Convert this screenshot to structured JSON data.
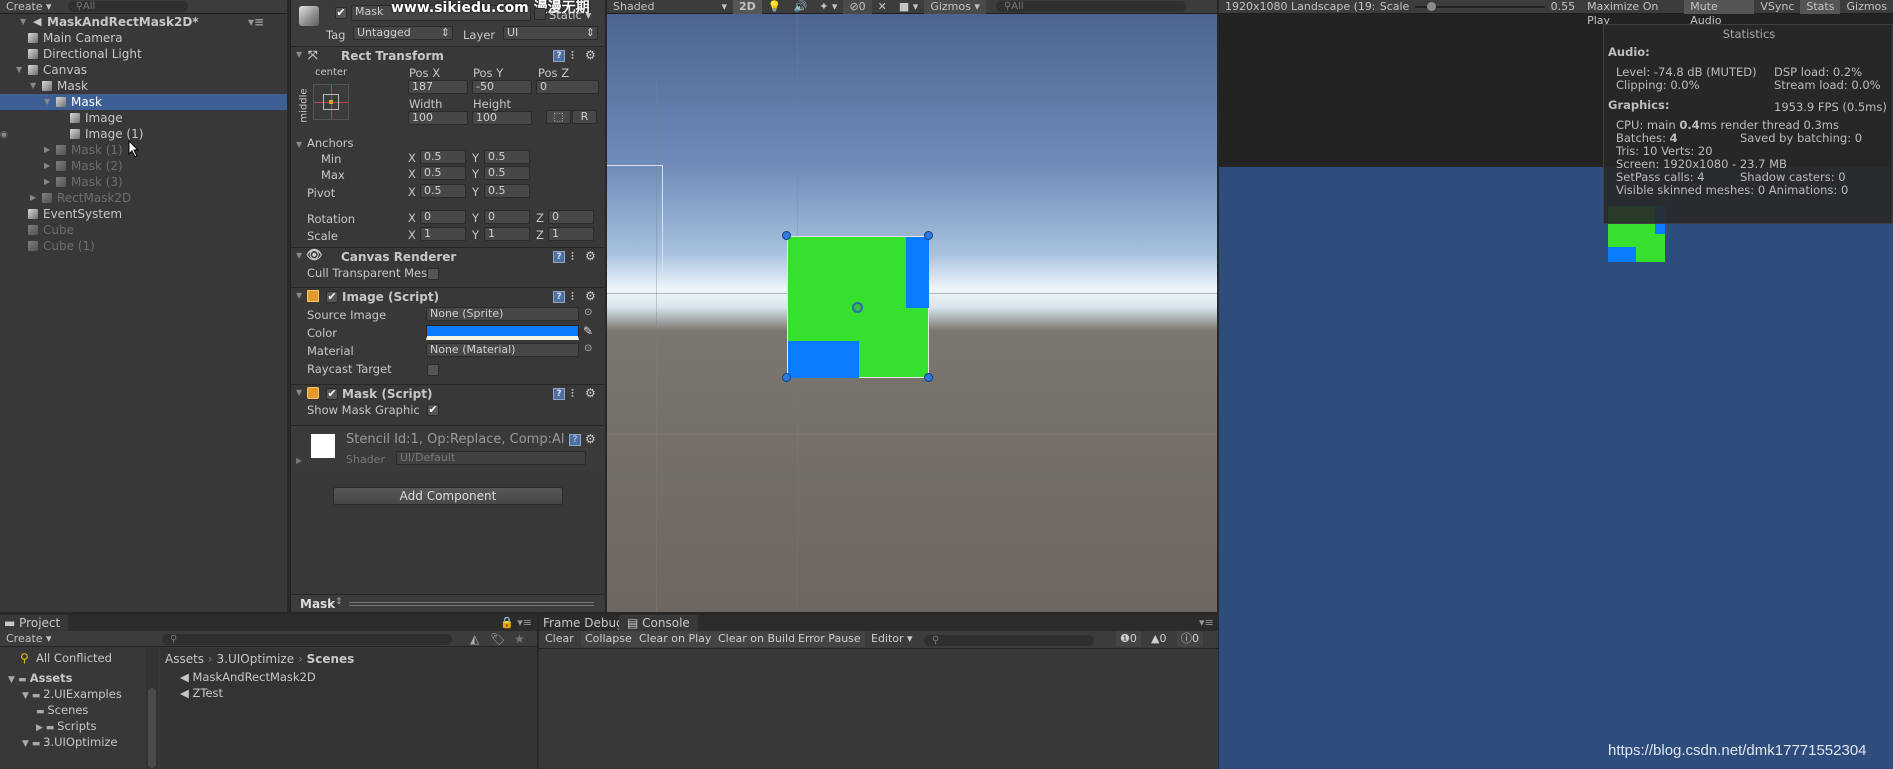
{
  "hierarchy": {
    "create_label": "Create",
    "search_placeholder": "All",
    "scene_name": "MaskAndRectMask2D*",
    "items": [
      {
        "label": "Main Camera",
        "depth": 1,
        "state": "normal"
      },
      {
        "label": "Directional Light",
        "depth": 1,
        "state": "normal"
      },
      {
        "label": "Canvas",
        "depth": 1,
        "state": "expanded"
      },
      {
        "label": "Mask",
        "depth": 2,
        "state": "expanded"
      },
      {
        "label": "Mask",
        "depth": 3,
        "state": "selected"
      },
      {
        "label": "Image",
        "depth": 4,
        "state": "normal"
      },
      {
        "label": "Image (1)",
        "depth": 4,
        "state": "normal"
      },
      {
        "label": "Mask (1)",
        "depth": 3,
        "state": "inactive"
      },
      {
        "label": "Mask (2)",
        "depth": 3,
        "state": "inactive"
      },
      {
        "label": "Mask (3)",
        "depth": 3,
        "state": "inactive"
      },
      {
        "label": "RectMask2D",
        "depth": 2,
        "state": "inactive"
      },
      {
        "label": "EventSystem",
        "depth": 1,
        "state": "normal"
      },
      {
        "label": "Cube",
        "depth": 1,
        "state": "inactive"
      },
      {
        "label": "Cube (1)",
        "depth": 1,
        "state": "inactive"
      }
    ]
  },
  "inspector": {
    "object_name": "Mask",
    "active": true,
    "static_label": "Static",
    "tag_label": "Tag",
    "tag_value": "Untagged",
    "layer_label": "Layer",
    "layer_value": "UI",
    "watermark": "www.sikiedu.com 漫漫无期",
    "rect_transform": {
      "title": "Rect Transform",
      "anchor_preset_h": "center",
      "anchor_preset_v": "middle",
      "pos_x_label": "Pos X",
      "pos_y_label": "Pos Y",
      "pos_z_label": "Pos Z",
      "pos_x": "187",
      "pos_y": "-50",
      "pos_z": "0",
      "width_label": "Width",
      "height_label": "Height",
      "width": "100",
      "height": "100",
      "raw_button": "R",
      "anchors_label": "Anchors",
      "min_label": "Min",
      "max_label": "Max",
      "min_x": "0.5",
      "min_y": "0.5",
      "max_x": "0.5",
      "max_y": "0.5",
      "pivot_label": "Pivot",
      "pivot_x": "0.5",
      "pivot_y": "0.5",
      "rotation_label": "Rotation",
      "rot_x": "0",
      "rot_y": "0",
      "rot_z": "0",
      "scale_label": "Scale",
      "scale_x": "1",
      "scale_y": "1",
      "scale_z": "1",
      "x": "X",
      "y": "Y",
      "z": "Z"
    },
    "canvas_renderer": {
      "title": "Canvas Renderer",
      "cull_label": "Cull Transparent Mes",
      "cull_checked": false
    },
    "image": {
      "title": "Image (Script)",
      "source_label": "Source Image",
      "source_value": "None (Sprite)",
      "color_label": "Color",
      "color_value": "#0a7cff",
      "material_label": "Material",
      "material_value": "None (Material)",
      "raycast_label": "Raycast Target",
      "raycast_checked": false
    },
    "mask": {
      "title": "Mask (Script)",
      "show_label": "Show Mask Graphic",
      "show_checked": true
    },
    "material": {
      "name": "Stencil Id:1, Op:Replace, Comp:Al",
      "shader_label": "Shader",
      "shader_value": "UI/Default"
    },
    "add_component": "Add Component",
    "preview_label": "Mask"
  },
  "scene": {
    "shading": "Shaded",
    "mode_2d": "2D",
    "hidden_count": "0",
    "gizmos": "Gizmos",
    "search_placeholder": "All",
    "colors": {
      "green": "#36e02e",
      "blue": "#0a7cff"
    }
  },
  "game": {
    "resolution": "1920x1080 Landscape (19:",
    "scale_label": "Scale",
    "scale_value": "0.55",
    "scale_fraction": 0.1,
    "buttons": [
      "Maximize On Play",
      "Mute Audio",
      "VSync",
      "Stats",
      "Gizmos"
    ],
    "stats": {
      "title": "Statistics",
      "audio_label": "Audio:",
      "level": "Level: -74.8 dB (MUTED)",
      "dsp": "DSP load: 0.2%",
      "clipping": "Clipping: 0.0%",
      "stream": "Stream load: 0.0%",
      "graphics_label": "Graphics:",
      "fps": "1953.9 FPS (0.5ms)",
      "cpu_prefix": "CPU: main ",
      "cpu_main": "0.4",
      "cpu_suffix": "ms  render thread 0.3ms",
      "batches_prefix": "Batches: ",
      "batches": "4",
      "saved": "Saved by batching: 0",
      "tris": "Tris: 10   Verts: 20",
      "screen": "Screen: 1920x1080 - 23.7 MB",
      "setpass": "SetPass calls: 4",
      "shadow": "Shadow casters: 0",
      "skinned": "Visible skinned meshes: 0  Animations: 0"
    },
    "bg_color": "#2f4d7c",
    "watermark": "https://blog.csdn.net/dmk17771552304"
  },
  "project": {
    "tab_label": "Project",
    "create_label": "Create",
    "favorites": [
      "All Conflicted"
    ],
    "tree": [
      {
        "label": "Assets",
        "depth": 0,
        "bold": true
      },
      {
        "label": "2.UIExamples",
        "depth": 1
      },
      {
        "label": "Scenes",
        "depth": 2
      },
      {
        "label": "Scripts",
        "depth": 2
      },
      {
        "label": "3.UIOptimize",
        "depth": 1
      }
    ],
    "breadcrumb": [
      "Assets",
      "3.UIOptimize",
      "Scenes"
    ],
    "files": [
      "MaskAndRectMask2D",
      "ZTest"
    ]
  },
  "console": {
    "tabs": [
      "Frame Debug",
      "Console"
    ],
    "buttons": [
      "Clear",
      "Collapse",
      "Clear on Play",
      "Clear on Build",
      "Error Pause",
      "Editor"
    ],
    "error_count": "0",
    "warning_count": "0",
    "info_count": "0"
  }
}
